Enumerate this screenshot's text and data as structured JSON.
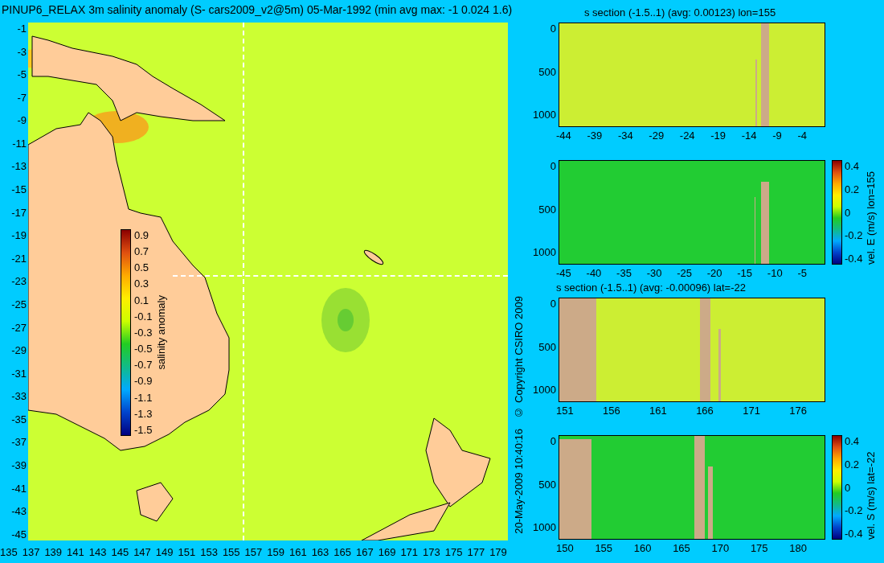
{
  "title": "PINUP6_RELAX 3m salinity anomaly (S- cars2009_v2@5m) 05-Mar-1992 (min avg max: -1 0.024 1.6)",
  "map": {
    "y_ticks": [
      "-1",
      "-3",
      "-5",
      "-7",
      "-9",
      "-11",
      "-13",
      "-15",
      "-17",
      "-19",
      "-21",
      "-23",
      "-25",
      "-27",
      "-29",
      "-31",
      "-33",
      "-35",
      "-37",
      "-39",
      "-41",
      "-43",
      "-45"
    ],
    "x_ticks": [
      "135",
      "137",
      "139",
      "141",
      "143",
      "145",
      "147",
      "149",
      "151",
      "153",
      "155",
      "157",
      "159",
      "161",
      "163",
      "165",
      "167",
      "169",
      "171",
      "173",
      "175",
      "177",
      "179"
    ],
    "colorbar": {
      "label": "salinity anomaly",
      "ticks": [
        "0.9",
        "0.7",
        "0.5",
        "0.3",
        "0.1",
        "-0.1",
        "-0.3",
        "-0.5",
        "-0.7",
        "-0.9",
        "-1.1",
        "-1.3",
        "-1.5"
      ]
    }
  },
  "credits": [
    "© Copyright CSIRO 2009",
    "20-May-2009 10:40:16"
  ],
  "sections": [
    {
      "kind": "salinity",
      "title": "s section (-1.5..1) (avg: 0.00123) lon=155",
      "y_ticks": [
        "0",
        "500",
        "1000"
      ],
      "x_ticks": [
        "-44",
        "-39",
        "-34",
        "-29",
        "-24",
        "-19",
        "-14",
        "-9",
        "-4"
      ]
    },
    {
      "kind": "velocity",
      "y_ticks": [
        "0",
        "500",
        "1000"
      ],
      "x_ticks": [
        "-45",
        "-40",
        "-35",
        "-30",
        "-25",
        "-20",
        "-15",
        "-10",
        "-5"
      ],
      "colorbar": {
        "label": "vel. E (m/s) lon=155",
        "ticks": [
          "0.4",
          "0.2",
          "0",
          "-0.2",
          "-0.4"
        ]
      }
    },
    {
      "kind": "salinity",
      "title": "s section (-1.5..1) (avg: -0.00096) lat=-22",
      "y_ticks": [
        "0",
        "500",
        "1000"
      ],
      "x_ticks": [
        "151",
        "156",
        "161",
        "166",
        "171",
        "176"
      ]
    },
    {
      "kind": "velocity",
      "y_ticks": [
        "0",
        "500",
        "1000"
      ],
      "x_ticks": [
        "150",
        "155",
        "160",
        "165",
        "170",
        "175",
        "180"
      ],
      "colorbar": {
        "label": "vel. S (m/s) lat=-22",
        "ticks": [
          "0.4",
          "0.2",
          "0",
          "-0.2",
          "-0.4"
        ]
      }
    }
  ]
}
